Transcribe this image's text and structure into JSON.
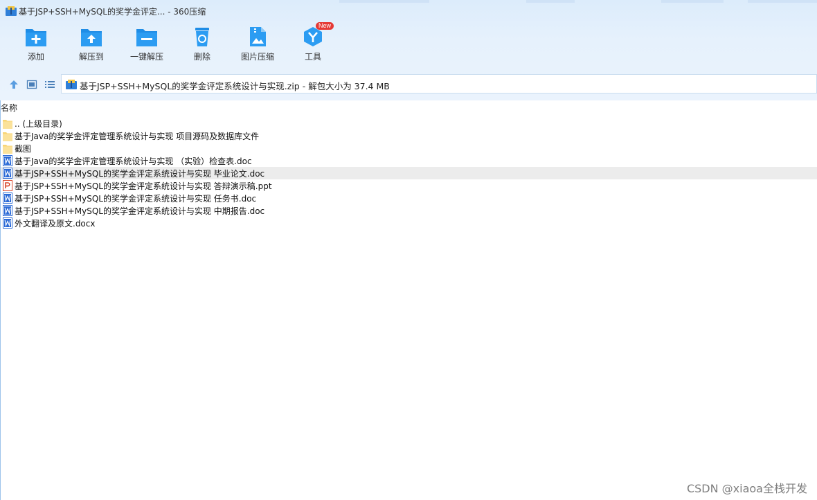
{
  "window": {
    "title": "基于JSP+SSH+MySQL的奖学金评定... - 360压缩"
  },
  "toolbar": {
    "items": [
      {
        "label": "添加",
        "icon": "add-icon"
      },
      {
        "label": "解压到",
        "icon": "extract-to-icon"
      },
      {
        "label": "一键解压",
        "icon": "one-click-extract-icon"
      },
      {
        "label": "删除",
        "icon": "delete-icon"
      },
      {
        "label": "图片压缩",
        "icon": "image-compress-icon"
      },
      {
        "label": "工具",
        "icon": "tools-icon",
        "badge": "New"
      }
    ]
  },
  "path": {
    "text": "基于JSP+SSH+MySQL的奖学金评定系统设计与实现.zip - 解包大小为 37.4 MB"
  },
  "list": {
    "column_name": "名称",
    "files": [
      {
        "name": ".. (上级目录)",
        "type": "folder"
      },
      {
        "name": "基于Java的奖学金评定管理系统设计与实现 项目源码及数据库文件",
        "type": "folder"
      },
      {
        "name": "截图",
        "type": "folder"
      },
      {
        "name": "基于Java的奖学金评定管理系统设计与实现 （实验）检查表.doc",
        "type": "word"
      },
      {
        "name": "基于JSP+SSH+MySQL的奖学金评定系统设计与实现 毕业论文.doc",
        "type": "word",
        "selected": true
      },
      {
        "name": "基于JSP+SSH+MySQL的奖学金评定系统设计与实现 答辩演示稿.ppt",
        "type": "ppt"
      },
      {
        "name": "基于JSP+SSH+MySQL的奖学金评定系统设计与实现 任务书.doc",
        "type": "word"
      },
      {
        "name": "基于JSP+SSH+MySQL的奖学金评定系统设计与实现 中期报告.doc",
        "type": "word"
      },
      {
        "name": "外文翻译及原文.docx",
        "type": "word"
      }
    ]
  },
  "watermark": {
    "text": "CSDN @xiaoa全栈开发"
  },
  "colors": {
    "accent": "#1e8ee6",
    "chrome_bg": "#e6f1fc",
    "folder": "#f8d575",
    "word": "#2b6ad6",
    "ppt": "#d9472b",
    "badge": "#e53935"
  }
}
